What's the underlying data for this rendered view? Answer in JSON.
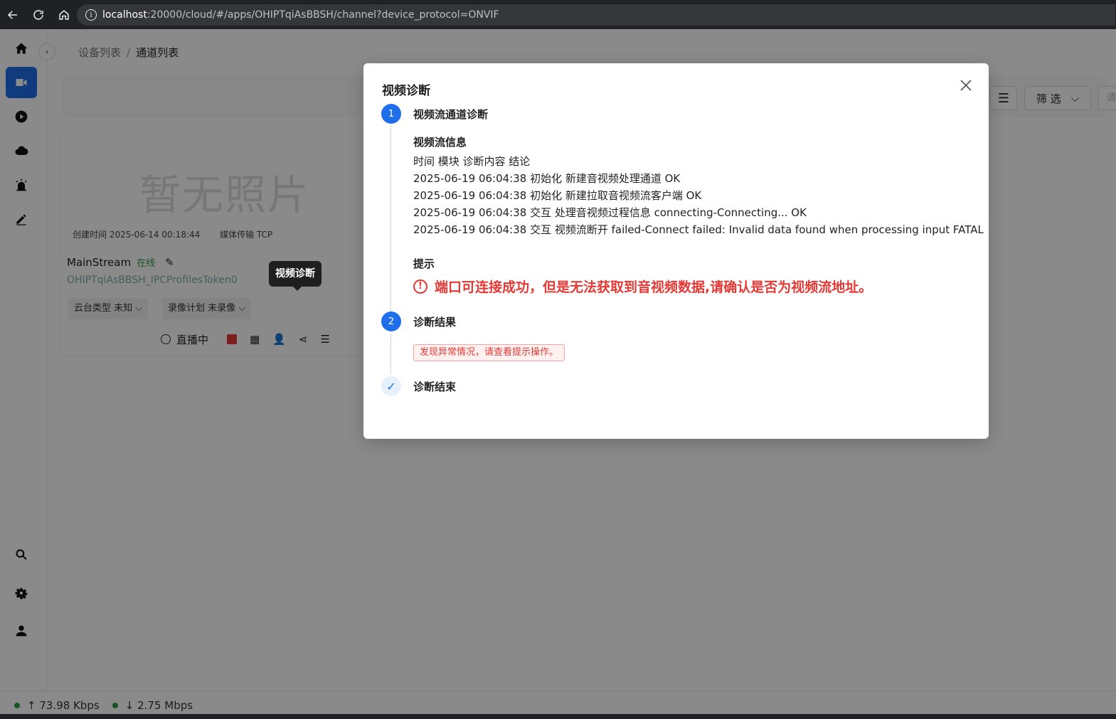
{
  "browser": {
    "url_host": "localhost",
    "url_rest": ":20000/cloud/#/apps/OHIPTqiAsBBSH/channel?device_protocol=ONVIF"
  },
  "breadcrumb": {
    "parent": "设备列表",
    "current": "通道列表"
  },
  "toolbar": {
    "filter_label": "筛 选",
    "search_placeholder": "请"
  },
  "card": {
    "no_photo": "暂无照片",
    "created": "创建时间 2025-06-14 00:18:44",
    "transport": "媒体传输 TCP",
    "name": "MainStream",
    "status": "在线",
    "channel_id": "OHIPTqiAsBBSH_IPCProfilesToken0",
    "ptz_type": "云台类型 未知",
    "record_plan": "录像计划 未录像",
    "live_label": "直播中",
    "tooltip": "视频诊断"
  },
  "statusbar": {
    "upload": "73.98 Kbps",
    "download": "2.75 Mbps"
  },
  "modal": {
    "title": "视频诊断",
    "steps": [
      {
        "num": "1",
        "title": "视频流通道诊断"
      },
      {
        "num": "2",
        "title": "诊断结果"
      },
      {
        "num": "✓",
        "title": "诊断结束"
      }
    ],
    "stream_info_title": "视频流信息",
    "log_lines": [
      "时间 模块 诊断内容 结论",
      "2025-06-19 06:04:38 初始化 新建音视频处理通道 OK",
      "2025-06-19 06:04:38 初始化 新建拉取音视频流客户端 OK",
      "2025-06-19 06:04:38 交互 处理音视频过程信息 connecting-Connecting... OK",
      "2025-06-19 06:04:38 交互 视频流断开 failed-Connect failed: Invalid data found when processing input FATAL"
    ],
    "hint_title": "提示",
    "hint_text": "端口可连接成功，但是无法获取到音视频数据,请确认是否为视频流地址。",
    "result_tag": "发现异常情况，请查看提示操作。"
  },
  "colors": {
    "accent": "#1f6feb",
    "error": "#e53935",
    "online": "#2e9e44"
  }
}
